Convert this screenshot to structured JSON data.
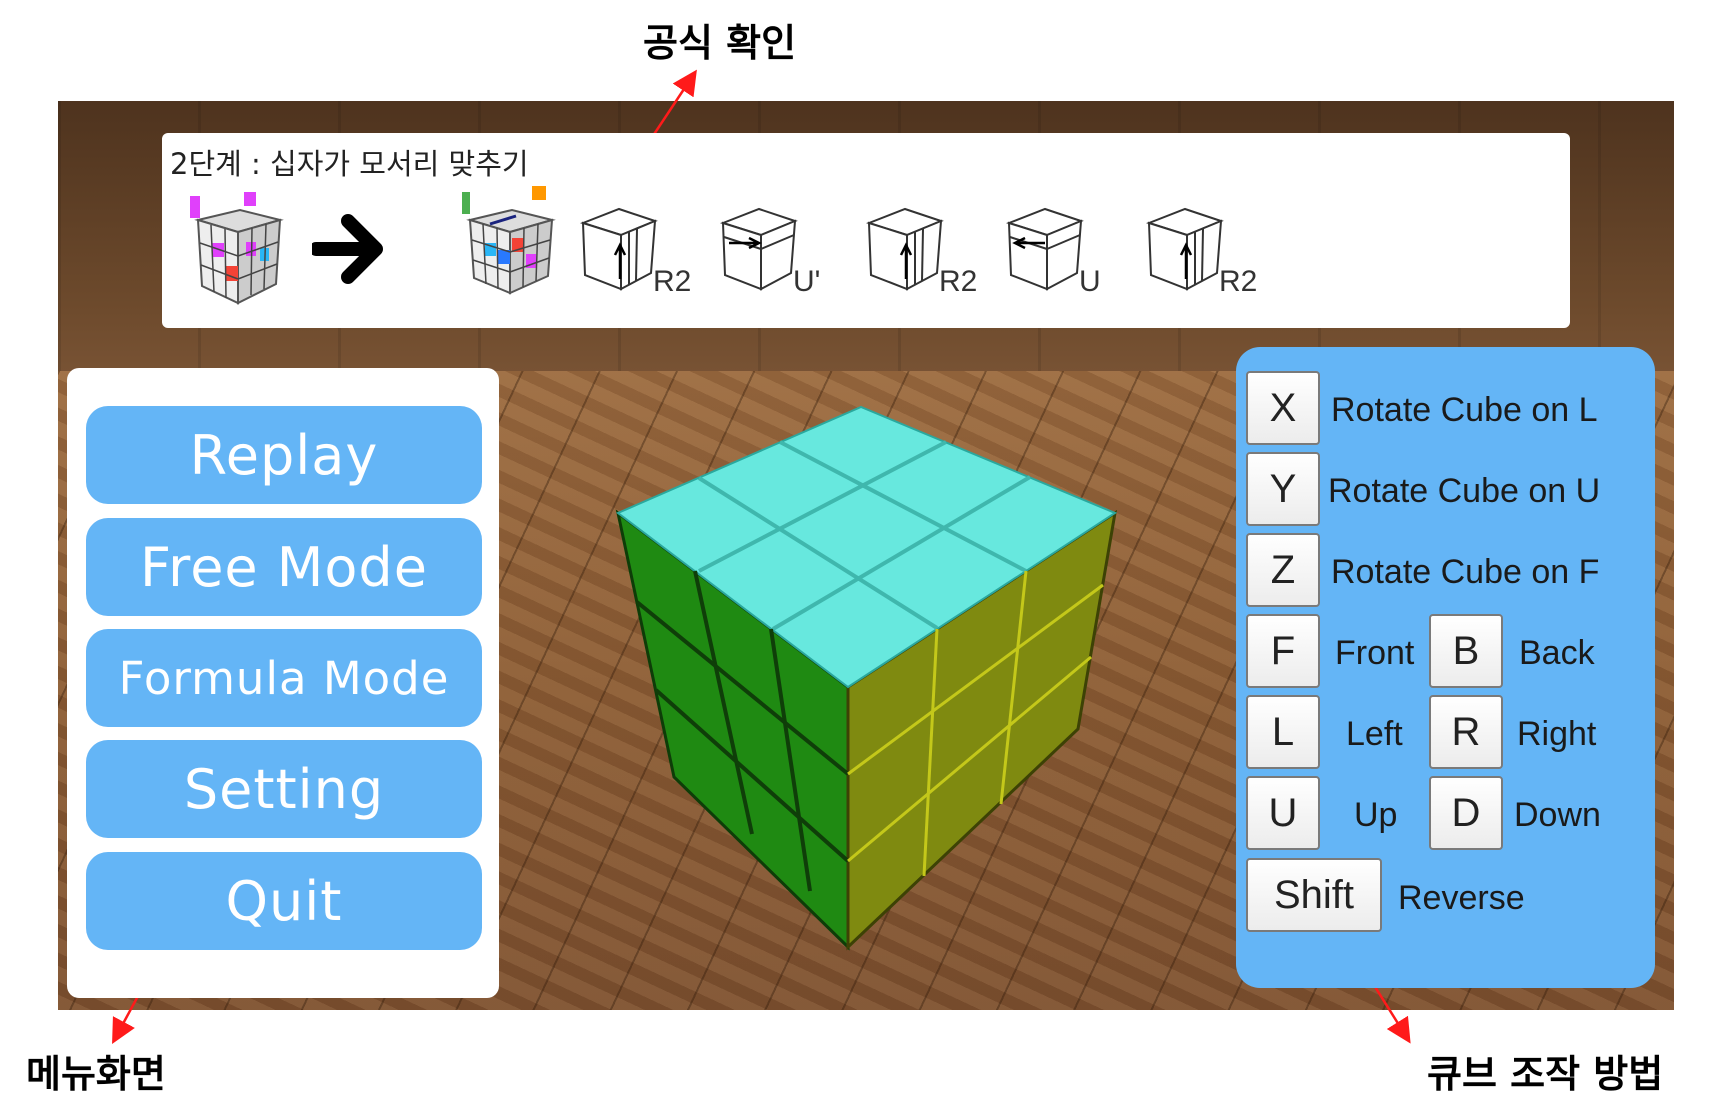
{
  "callouts": {
    "formula": "공식 확인",
    "menu": "메뉴화면",
    "controls": "큐브 조작 방법"
  },
  "formula_panel": {
    "title": "2단계 : 십자가 모서리 맞추기",
    "steps": [
      {
        "label": "R2",
        "icon": "up-arrow-icon"
      },
      {
        "label": "U'",
        "icon": "right-arrow-icon"
      },
      {
        "label": "R2",
        "icon": "up-arrow-icon"
      },
      {
        "label": "U",
        "icon": "left-arrow-icon"
      },
      {
        "label": "R2",
        "icon": "up-arrow-icon"
      }
    ]
  },
  "menu": {
    "items": [
      {
        "label": "Replay"
      },
      {
        "label": "Free Mode"
      },
      {
        "label": "Formula Mode"
      },
      {
        "label": "Setting"
      },
      {
        "label": "Quit"
      }
    ]
  },
  "controls": {
    "rotate": [
      {
        "key": "X",
        "label": "Rotate Cube on L"
      },
      {
        "key": "Y",
        "label": "Rotate Cube on U"
      },
      {
        "key": "Z",
        "label": "Rotate Cube on F"
      }
    ],
    "faces": [
      {
        "key": "F",
        "label": "Front",
        "key2": "B",
        "label2": "Back"
      },
      {
        "key": "L",
        "label": "Left",
        "key2": "R",
        "label2": "Right"
      },
      {
        "key": "U",
        "label": "Up",
        "key2": "D",
        "label2": "Down"
      }
    ],
    "shift": {
      "key": "Shift",
      "label": "Reverse"
    }
  },
  "colors": {
    "accent": "#64b5f6",
    "cube_top": "#67e8de",
    "cube_left": "#1f8a12",
    "cube_right": "#7f8a10",
    "annotation_arrow": "#ff1a1a"
  }
}
